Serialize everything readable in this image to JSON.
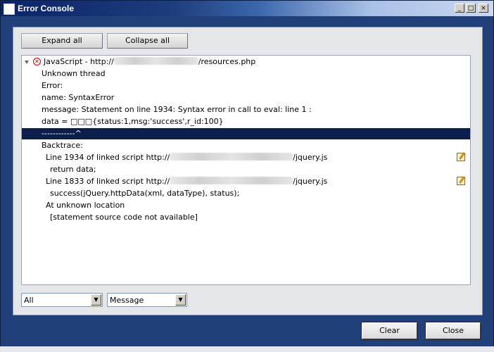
{
  "window": {
    "title": "Error Console",
    "controls": {
      "minimize": "_",
      "maximize": "□",
      "close": "×"
    }
  },
  "toolbar": {
    "expand_all": "Expand all",
    "collapse_all": "Collapse all"
  },
  "log": {
    "header_prefix": "JavaScript - http://",
    "header_suffix": "/resources.php",
    "lines": [
      "Unknown thread",
      "Error:",
      "name: SyntaxError",
      "message: Statement on line 1934: Syntax error in call to eval: line 1 :",
      "data = □□□{status:1,msg:'success',r_id:100}"
    ],
    "selected_line": "------------^",
    "backtrace_label": "Backtrace:",
    "frame1_prefix": "Line 1934 of linked script http://",
    "frame1_suffix": "/jquery.js",
    "frame1_code": "return data;",
    "frame2_prefix": "Line 1833 of linked script http://",
    "frame2_suffix": "/jquery.js",
    "frame2_code": "success(jQuery.httpData(xml, dataType), status);",
    "frame3": "At unknown location",
    "frame3_code": "[statement source code not available]"
  },
  "filters": {
    "source": "All",
    "type": "Message"
  },
  "buttons": {
    "clear": "Clear",
    "close": "Close"
  }
}
